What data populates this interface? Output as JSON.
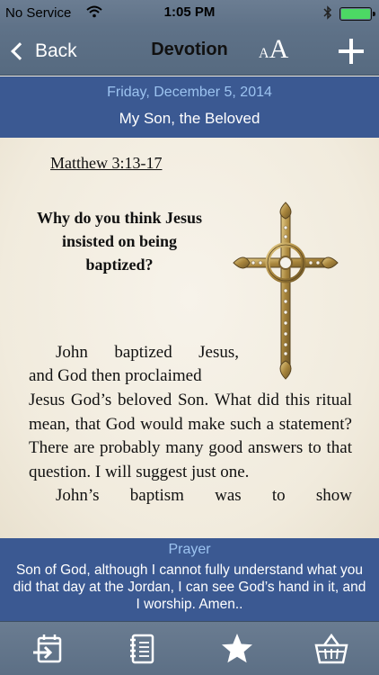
{
  "status_bar": {
    "carrier": "No Service",
    "time": "1:05 PM",
    "wifi_icon": "wifi-icon",
    "bluetooth_icon": "bluetooth-icon",
    "battery_level": 1.0
  },
  "nav": {
    "back_label": "Back",
    "title": "Devotion",
    "font_small": "A",
    "font_large": "A"
  },
  "header": {
    "date": "Friday, December 5, 2014",
    "title": "My Son, the Beloved"
  },
  "devotion": {
    "reference": "Matthew 3:13-17",
    "question": "Why do you think Jesus insisted on being baptized?",
    "para1_line1": "John baptized Jesus,",
    "para1_line2": "and God then proclaimed",
    "para1_rest": "Jesus God’s beloved Son. What did this ritual mean, that God would make such a statement? There are probably many good answers to that question. I will suggest just one.",
    "para2": "John’s baptism was to show"
  },
  "prayer": {
    "label": "Prayer",
    "text": "Son of God, although I cannot fully understand what you did that day at the Jordan, I can see God’s hand in it, and I worship. Amen.."
  },
  "tabs": [
    {
      "icon": "calendar-enter-icon"
    },
    {
      "icon": "notebook-icon"
    },
    {
      "icon": "star-icon"
    },
    {
      "icon": "basket-icon"
    }
  ],
  "colors": {
    "bar": "#5f7288",
    "header_blue": "#3b5992",
    "accent_light_blue": "#9cc3f0"
  }
}
